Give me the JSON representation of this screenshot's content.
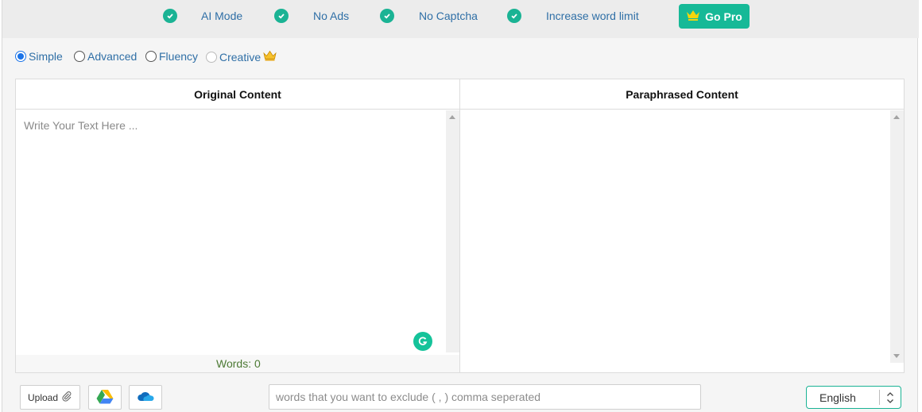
{
  "promo": {
    "features": [
      {
        "label": "AI Mode"
      },
      {
        "label": "No Ads"
      },
      {
        "label": "No Captcha"
      },
      {
        "label": "Increase word limit"
      }
    ],
    "go_pro_label": "Go Pro"
  },
  "modes": [
    {
      "label": "Simple",
      "selected": true,
      "enabled": true
    },
    {
      "label": "Advanced",
      "selected": false,
      "enabled": true
    },
    {
      "label": "Fluency",
      "selected": false,
      "enabled": true
    },
    {
      "label": "Creative",
      "selected": false,
      "enabled": false,
      "premium": true
    }
  ],
  "editor": {
    "original_title": "Original Content",
    "paraphrased_title": "Paraphrased Content",
    "input_placeholder": "Write Your Text Here ...",
    "word_count_label": "Words: 0"
  },
  "toolbar": {
    "upload_label": "Upload",
    "exclude_placeholder": "words that you want to exclude ( , ) comma seperated",
    "language_selected": "English"
  },
  "colors": {
    "accent": "#1ab394",
    "link": "#2f6fa6"
  }
}
